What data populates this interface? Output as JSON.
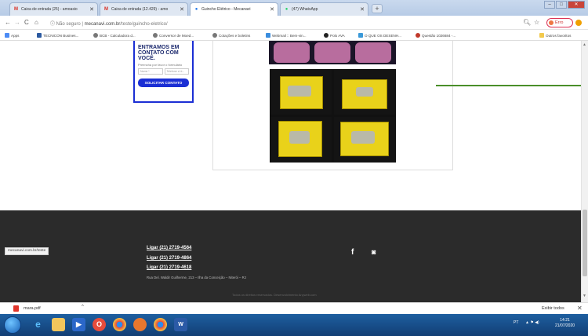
{
  "tabs": [
    {
      "label": "Caixa de entrada (25) - amoasio",
      "icon": "gmail-icon",
      "active": false
    },
    {
      "label": "Caixa de entrada (12.429) - amo",
      "icon": "gmail-icon",
      "active": false
    },
    {
      "label": "Guincho Elétrico - Mecanavi",
      "icon": "globe-icon",
      "active": true
    },
    {
      "label": "(47) WhatsApp",
      "icon": "whatsapp-icon",
      "active": false
    }
  ],
  "address": {
    "security": "Não seguro",
    "url_host": "mecanavi.com.br",
    "url_path": "/teste/guincho-eletrico/",
    "profile_label": "Erro"
  },
  "bookmarks": {
    "items": [
      "Apps",
      "TECNICON Busines...",
      "BCB - Calculadora d...",
      "Conversor de Moed...",
      "Cotações e boletins",
      "Webmail :: Bem-vin...",
      "Polo AVA",
      "O QUE OS DESENH...",
      "Questão 1026684 -..."
    ],
    "other": "Outros favoritos"
  },
  "contact_card": {
    "title": "ENTRAMOS EM CONTATO COM VOCÊ.",
    "subtitle": "Preencha por favor o formulário",
    "name_placeholder": "Nome *",
    "phone_placeholder": "Telefone c/ d...",
    "button": "SOLICITAR CONTATO"
  },
  "footer": {
    "phones": [
      "Ligar (21) 2719-4564",
      "Ligar (21) 2719-4864",
      "Ligar (21) 2719-4618"
    ],
    "address": "Rua Del. Waldir Guilherme, 213 – Ilha da Conceição – Niterói – RJ",
    "social": [
      "f",
      "◙"
    ],
    "copyright": "Todos os direitos reservados. Desenvolvimento Anyweb.com"
  },
  "status_url": "mecanavi.com.br/teste",
  "downloads": {
    "file": "mara.pdf",
    "show_all": "Exibir todos"
  },
  "taskbar": {
    "tray_lang": "PT",
    "time": "14:21",
    "date": "21/07/2020"
  }
}
